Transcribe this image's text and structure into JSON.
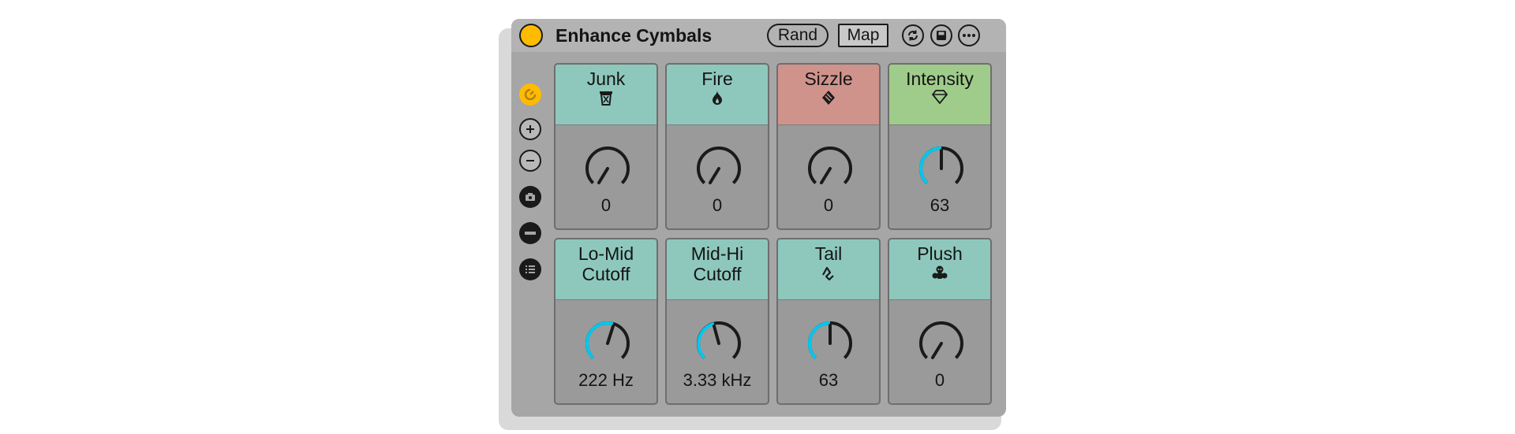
{
  "device": {
    "title": "Enhance Cymbals",
    "rand_label": "Rand",
    "map_label": "Map"
  },
  "colors": {
    "accent_power": "#ffbb00",
    "knob_arc": "#00c8f0",
    "header_teal": "#8ec8bc",
    "header_red": "#cf938c",
    "header_green": "#9fcc8a"
  },
  "macros": [
    {
      "label": "Junk",
      "value": "0",
      "icon": "trash-can-icon",
      "header": "teal",
      "level": 0
    },
    {
      "label": "Fire",
      "value": "0",
      "icon": "flame-icon",
      "header": "teal",
      "level": 0
    },
    {
      "label": "Sizzle",
      "value": "0",
      "icon": "sizzle-icon",
      "header": "red",
      "level": 0
    },
    {
      "label": "Intensity",
      "value": "63",
      "icon": "diamond-icon",
      "header": "green",
      "level": 0.5
    },
    {
      "label": "Lo-Mid\nCutoff",
      "value": "222 Hz",
      "icon": "",
      "header": "teal",
      "level": 0.6
    },
    {
      "label": "Mid-Hi\nCutoff",
      "value": "3.33 kHz",
      "icon": "",
      "header": "teal",
      "level": 0.45
    },
    {
      "label": "Tail",
      "value": "63",
      "icon": "tail-squiggle-icon",
      "header": "teal",
      "level": 0.5
    },
    {
      "label": "Plush",
      "value": "0",
      "icon": "plush-icon",
      "header": "teal",
      "level": 0
    }
  ]
}
